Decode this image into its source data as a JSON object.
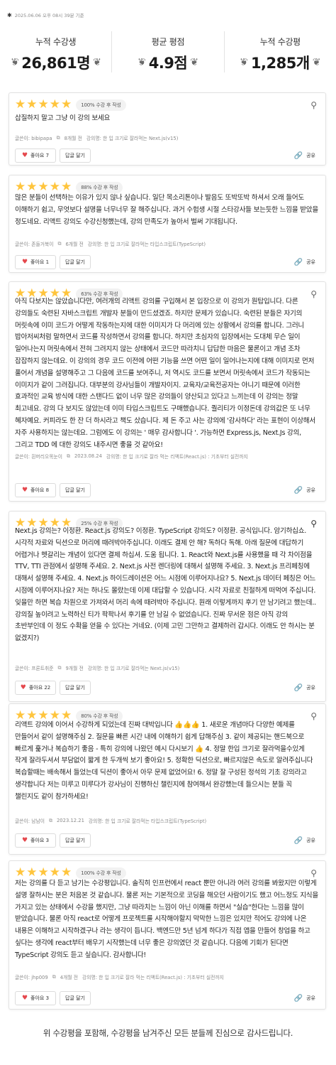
{
  "timestamp": "2025.06.06 오후 08시 39분 기준",
  "stats": [
    {
      "label": "누적 수강생",
      "value": "26,861명"
    },
    {
      "label": "평균 평점",
      "value": "4.9점"
    },
    {
      "label": "누적 수강평",
      "value": "1,285개"
    }
  ],
  "reviews": [
    {
      "rating": 5,
      "badge": "100% 수강 후 작성",
      "text": "삽질하지 말고 그냥 이 강의 보세요",
      "author": "글쓴이: bibipapa",
      "date": "8개월 전",
      "course": "강의명: 한 입 크기로 잘라먹는 Next.js(v15)",
      "likes": "좋아요 7",
      "reply": "답글 달기",
      "share": "공유"
    },
    {
      "rating": 5,
      "badge": "88% 수강 후 작성",
      "text": "많은 분들이 선택하는 이유가 있지 않나 싶습니다. 일단 목소리톤이나 발음도 또박또박 하셔서 오래 들어도 이해하기 쉽고, 무엇보다 설명을 너무너무 잘 해주십니다. 과거 수험생 시절 스타강사들 보는듯한 느낌을 받았을 정도네요. 리액트 강의도 수강신청했는데, 강의 만족도가 높아서 벌써 기대됩니다.",
      "author": "글쓴이: 존들거북이",
      "date": "6개월 전",
      "course": "강의명: 한 입 크기로 잘라먹는 타입스크립트(TypeScript)",
      "likes": "좋아요 1",
      "reply": "답글 달기",
      "share": "공유"
    },
    {
      "rating": 5,
      "badge": "63% 수강 후 작성",
      "text": "아직 다보지는 않았습니다만, 여러개의 리액트 강의를 구입해서 본 입장으로 이 강의가 원탑입니다. 다른 강의들도 숙련된 자바스크립트 개발자 분들이 만드셨겠죠. 하지만 문제가 있습니다. 숙련된 분들은 자기의 머릿속에 이미 코드가 어떻게 작동하는지에 대한 이미지가 다 머리에 있는 상황에서 강의를 합니다. 그러니 밥아저씨처럼 말하면서 코드를 작성하면서 강의를 합니다. 하지만 초심자의 입장에서는 도대체 무슨 일이 일어나는지 머릿속에서 전혀 그려지지 않는 상태에서 코드만 따라치니 답답한 마음은 물론이고 개념 조차 잡잡하지 않는데요. 이 강의의 경우 코드 이전에 어떤 기능을 쓰면 어떤 일이 일어나는지에 대해 이미지로 먼저 풀어서 개념을 설명해주고 그 다음에 코드를 보여주니, 저 역시도 코드를 보면서 머릿속에서 코드가 작동되는 이미지가 같이 그려집니다. 대부분의 강사님들이 개발자이지. 교육자/교육전공자는 아니기 때문에 이러한 효과적인 교육 방식에 대한 스탠다드 없이 너무 많은 강의들이 양산되고 있다고 느끼는데 이 강의는 정말 최고네요. 강의 다 보지도 않았는데 이미 타입스크립트도 구매했습니다. 퀄리티가 이정돈데 강의값은 또 너무 혜자예요. 커피라도 한 잔 더 하시라고 책도 샀습니다. 제 돈 주고 사는 강의에 '감사하다' 라는 표현이 이상해서 자주 사용하지는 않는데요. 그럼에도 이 강의는 ' 매우 감사합니다 '. 가능하면 Express.js, Next.Js 강의, 그리고 TDD 에 대한 강의도 내주시면 좋을 것 같아요!",
      "author": "글쓴이: 흰머리오목눈이",
      "date": "2023.08.24",
      "course": "강의명: 한 입 크기로 잘라 먹는 리액트(React.js) : 기초부터 실전까지",
      "likes": "좋아요 8",
      "reply": "답글 달기",
      "share": "공유"
    },
    {
      "rating": 5,
      "badge": "25% 수강 후 작성",
      "text": "Next.js 강의는? 이정환. React.js 강의도? 이정환. TypeScript 강의도? 이정환. 공식입니다. 암기하십쇼. 시각적 자료와 딕션으로 머리에 때려박아주십니다. 이래도 결제 안 해? 독하다 독해. 아래 질문에 대답하기 어렵거나 헷갈리는 개념이 있다면 결제 하십셔. 도움 됩니다. 1. React와 Next.js를 사용했을 때 각 차이점을 TTV, TTI 관점에서 설명해 주세요. 2. Next.js 사전 렌더링에 대해서 설명해 주세요. 3. Next.js 프리페칭에 대해서 설명해 주세요. 4. Next.js 하이드레이션은 어느 시점에 이루어지나요? 5. Next.js 데이터 페칭은 어느 시점에 이루어지나요? 저는 하나도 몰랐는데 이제 대답할 수 있습니다. 시각 자료로 친절하게 떠먹여 주십니다. 잊을만 하면 복습 차원으로 가져와서 머리 속에 때려박아 주십니다. 원래 이렇게까지 후기 안 남기려고 했는데.. 강의질 높이려고 노력하신 티가 팍팍나서 후기를 안 남길 수 없었습니다. 진짜 무서운 점은 아직 강의 초반부인데 이 정도 수확을 얻을 수 있다는 거네요. (이제 고민 그만하고 결제하러 갑시다. 이래도 안 하시는 분 없겠지?)",
      "author": "글쓴이: 프론트취준",
      "date": "9개월 전",
      "course": "강의명: 한 입 크기로 잘라먹는 Next.js(v15)",
      "likes": "좋아요 22",
      "reply": "답글 달기",
      "share": "공유"
    },
    {
      "rating": 5,
      "badge": "80% 수강 후 작성",
      "text": "리액트 강의에 이어서 수강하게 되었는데 진짜 대박입니다 👍👍👍 1. 새로운 개념마다 다양한 예제를 만들어서 같이 설명해주심 2. 질문을 빠른 시간 내에 이해하기 쉽게 답해주심 3. 같이 제공되는 핸드북으로 빠르게 훑거나 복습하기 좋음 - 특히 강의에 나왔던 예시 다시보기 👍 4. 정말 한입 크기로 잘라먹을수있게 작게 잘라두셔서 부담없이 짧게 한 두개씩 보기 좋아요! 5. 정확한 딕션으로, 빠르지않은 속도로 알려주십니다 복습할때는 배속해서 들었는데 딕션이 좋아서 아무 문제 없었어요! 6. 정말 잘 구성된 정석의 기초 강의라고 생각합니다 저는 미루고 미루다가 강사님이 진행하신 챌린지에 참여해서 완강했는데 들으시는 분들 꼭 챌린지도 같이 참가하세요!",
      "author": "글쓴이: 남남이",
      "date": "2023.12.21",
      "course": "강의명: 한 입 크기로 잘라먹는 타입스크립트(TypeScript)",
      "likes": "좋아요 3",
      "reply": "답글 달기",
      "share": "공유"
    },
    {
      "rating": 5,
      "badge": "100% 수강 후 작성",
      "text": "저는 강의를 다 듣고 남기는 수강평입니다. 솔직히 인프런에서 react 뿐만 아니라 여러 강의를 봐왔지만 이렇게 설명 잘하시는 분은 처음본 것 같습니다. 물론 저는 기본적으로 코딩을 해오던 사람이기도 했고 어느정도 지식을 가지고 있는 상태에서 수강을 했지만, 그냥 따라치는 느낌이 아닌 이해를 하면서 \"실습\"한다는 느낌을 많이 받았습니다. 물론 아직 react로 어떻게 프로젝트를 시작해야할지 막막한 느낌은 있지만 적어도 강의에 나온 내용은 이해하고 시작하겠구나 라는 생각이 듭니다. 백엔드만 5년 넘게 하다가 직접 앱을 만들어 창업을 하고 싶다는 생각에 react부터 배우기 시작했는데 너무 좋은 강의였던 것 같습니다. 다음에 기회가 된다면 TypeScript 강의도 듣고 싶습니다. 감사합니다!",
      "author": "글쓴이: jhp009",
      "date": "4개월 전",
      "course": "강의명: 한 입 크기로 잘라 먹는 리액트(React.js) : 기초부터 실전까지",
      "likes": "좋아요 3",
      "reply": "답글 달기",
      "share": "공유"
    }
  ],
  "footer": "위 수강평을 포함해, 수강평을 남겨주신 모든 분들께 진심으로 감사드립니다.",
  "colors": {
    "star": "#ffc53d",
    "heart": "#e5484d",
    "badge_bg": "#f2f2f2"
  }
}
